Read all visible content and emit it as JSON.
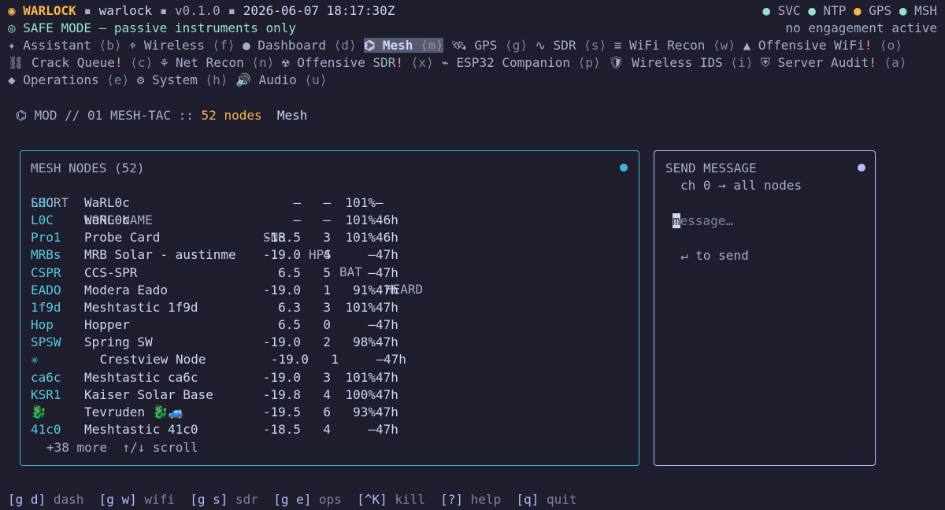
{
  "header": {
    "app_icon": "◉",
    "app_name": "WARLOCK",
    "sep": "▪",
    "host": "warlock",
    "version": "v0.1.0",
    "datetime": "2026-06-07 18:17:30Z",
    "status_items": [
      {
        "label": "SVC",
        "color": "#94e2d5"
      },
      {
        "label": "NTP",
        "color": "#94e2d5"
      },
      {
        "label": "GPS",
        "color": "#f9b64b"
      },
      {
        "label": "MSH",
        "color": "#94e2d5"
      }
    ],
    "safe_mode_icon": "◎",
    "safe_mode": "SAFE MODE — passive instruments only",
    "engagement": "no engagement active"
  },
  "nav": {
    "rows": [
      [
        {
          "icon": "✦",
          "label": "Assistant",
          "key": "⟨b⟩"
        },
        {
          "icon": "⌖",
          "label": "Wireless",
          "key": "⟨f⟩"
        },
        {
          "icon": "●",
          "label": "Dashboard",
          "key": "⟨d⟩"
        },
        {
          "icon": "⌬",
          "label": "Mesh",
          "key": "⟨m⟩",
          "active": true
        },
        {
          "icon": "🛰",
          "label": "GPS",
          "key": "⟨g⟩"
        },
        {
          "icon": "∿",
          "label": "SDR",
          "key": "⟨s⟩"
        },
        {
          "icon": "≡",
          "label": "WiFi Recon",
          "key": "⟨w⟩"
        },
        {
          "icon": "▲",
          "label": "Offensive WiFi",
          "excl": "!",
          "key": "⟨o⟩"
        }
      ],
      [
        {
          "icon": "⛓",
          "label": "Crack Queue",
          "excl": "!",
          "key": "⟨c⟩"
        },
        {
          "icon": "⚘",
          "label": "Net Recon",
          "key": "⟨n⟩"
        },
        {
          "icon": "☢",
          "label": "Offensive SDR",
          "excl": "!",
          "key": "⟨x⟩"
        },
        {
          "icon": "⌁",
          "label": "ESP32 Companion",
          "key": "⟨p⟩"
        },
        {
          "icon": "🛡",
          "label": "Wireless IDS",
          "key": "⟨i⟩"
        },
        {
          "icon": "⛨",
          "label": "Server Audit",
          "excl": "!",
          "key": "⟨a⟩"
        }
      ],
      [
        {
          "icon": "◆",
          "label": "Operations",
          "key": "⟨e⟩"
        },
        {
          "icon": "⚙",
          "label": "System",
          "key": "⟨h⟩"
        },
        {
          "icon": "🔊",
          "label": "Audio",
          "key": "⟨u⟩"
        }
      ]
    ]
  },
  "mod": {
    "icon": "⌬",
    "path": "MOD // 01 MESH-TAC ::",
    "count": "52 nodes",
    "name": "Mesh"
  },
  "nodes_panel": {
    "title": "MESH NODES (52)",
    "columns": {
      "short": "SHORT",
      "long": "LONG NAME",
      "snr": "SNR",
      "hps": "HPS",
      "bat": "BAT",
      "heard": "HEARD"
    },
    "rows": [
      {
        "short": "L0C",
        "long": "WaRL0c",
        "snr": "—",
        "hps": "—",
        "bat": "101%",
        "heard": "—"
      },
      {
        "short": "L0C",
        "long": "WaRL0c",
        "snr": "—",
        "hps": "—",
        "bat": "101%",
        "heard": "46h"
      },
      {
        "short": "Pro1",
        "long": "Probe Card",
        "snr": "-18.5",
        "hps": "3",
        "bat": "101%",
        "heard": "46h"
      },
      {
        "short": "MRBs",
        "long": "MRB Solar - austinme",
        "snr": "-19.0",
        "hps": "4",
        "bat": "—",
        "heard": "47h"
      },
      {
        "short": "CSPR",
        "long": "CCS-SPR",
        "snr": "6.5",
        "hps": "5",
        "bat": "—",
        "heard": "47h"
      },
      {
        "short": "EADO",
        "long": "Modera Eado",
        "snr": "-19.0",
        "hps": "1",
        "bat": "91%",
        "heard": "47h"
      },
      {
        "short": "1f9d",
        "long": "Meshtastic 1f9d",
        "snr": "6.3",
        "hps": "3",
        "bat": "101%",
        "heard": "47h"
      },
      {
        "short": "Hop",
        "long": "Hopper",
        "snr": "6.5",
        "hps": "0",
        "bat": "—",
        "heard": "47h"
      },
      {
        "short": "SPSW",
        "long": "Spring SW",
        "snr": "-19.0",
        "hps": "2",
        "bat": "98%",
        "heard": "47h"
      },
      {
        "short": "✳",
        "long": " Crestview Node",
        "snr": "-19.0",
        "hps": "1",
        "bat": "—",
        "heard": "47h",
        "shifted": true
      },
      {
        "short": "ca6c",
        "long": "Meshtastic ca6c",
        "snr": "-19.0",
        "hps": "3",
        "bat": "101%",
        "heard": "47h"
      },
      {
        "short": "KSR1",
        "long": "Kaiser Solar Base",
        "snr": "-19.8",
        "hps": "4",
        "bat": "100%",
        "heard": "47h"
      },
      {
        "short": "🐉",
        "long": "Tevruden 🐉🚙",
        "snr": "-19.5",
        "hps": "6",
        "bat": "93%",
        "heard": "47h"
      },
      {
        "short": "41c0",
        "long": "Meshtastic 41c0",
        "snr": "-18.5",
        "hps": "4",
        "bat": "—",
        "heard": "47h"
      }
    ],
    "more": "+38 more  ↑/↓ scroll",
    "dot_color": "#3fb6cf"
  },
  "send_panel": {
    "title": "SEND MESSAGE",
    "channel": "ch 0 → all nodes",
    "placeholder_first": "m",
    "placeholder_rest": "essage…",
    "hint": "↵ to send",
    "dot_color": "#b4befe"
  },
  "footer": [
    {
      "key": "[g d]",
      "label": "dash"
    },
    {
      "key": "[g w]",
      "label": "wifi"
    },
    {
      "key": "[g s]",
      "label": "sdr"
    },
    {
      "key": "[g e]",
      "label": "ops"
    },
    {
      "key": "[^K]",
      "label": "kill"
    },
    {
      "key": "[?]",
      "label": "help"
    },
    {
      "key": "[q]",
      "label": "quit"
    }
  ]
}
